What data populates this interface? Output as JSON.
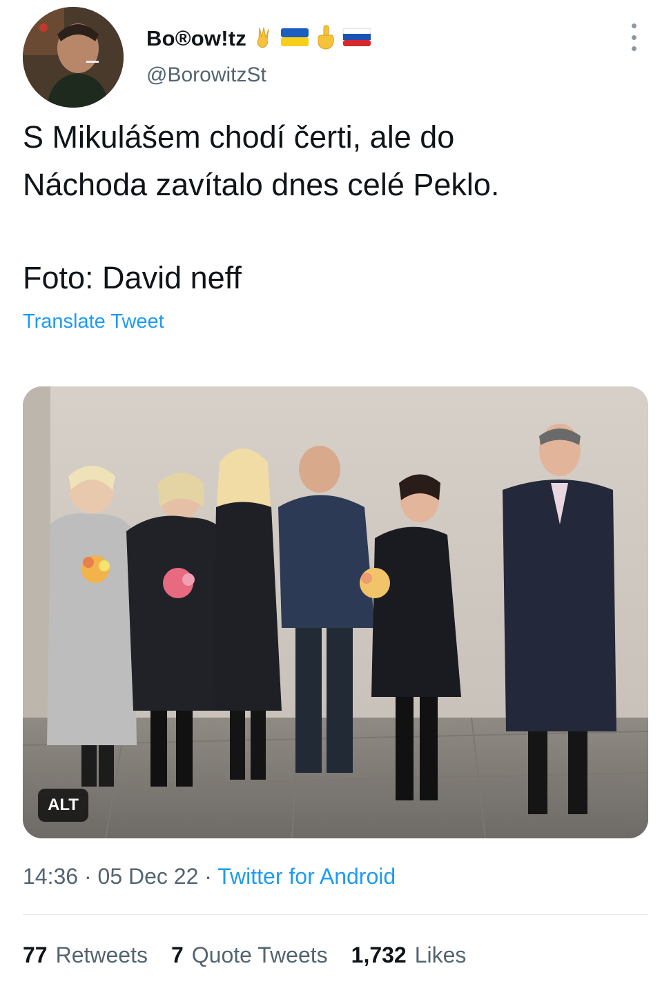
{
  "author": {
    "display_name": "Bo®ow!tz",
    "handle": "@BorowitzSt",
    "name_emojis": [
      "peace-hand-emoji",
      "ukraine-flag-emoji",
      "middle-finger-emoji",
      "russia-flag-emoji"
    ]
  },
  "tweet": {
    "lines": [
      "S Mikulášem chodí čerti, ale do",
      "Náchoda zavítalo dnes celé Peklo.",
      "Foto: David neff"
    ],
    "translate_label": "Translate Tweet"
  },
  "media": {
    "alt_label": "ALT"
  },
  "meta": {
    "time": "14:36",
    "sep1": " · ",
    "date": "05 Dec 22",
    "sep2": " · ",
    "source": "Twitter for Android"
  },
  "stats": {
    "retweets_count": "77",
    "retweets_label": "Retweets",
    "quotes_count": "7",
    "quotes_label": "Quote Tweets",
    "likes_count": "1,732",
    "likes_label": "Likes"
  },
  "colors": {
    "link": "#1d9bf0",
    "text": "#0f1419",
    "secondary": "#536471"
  }
}
